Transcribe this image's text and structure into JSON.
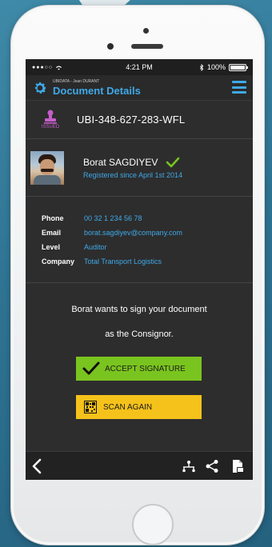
{
  "status_bar": {
    "time": "4:21 PM",
    "battery": "100%",
    "battery_level": 1.0,
    "signal_icon": "signal-dots-icon",
    "wifi_icon": "wifi-icon",
    "bluetooth_icon": "bluetooth-icon"
  },
  "app_bar": {
    "subtitle": "UBIDATA - Jean DURANT",
    "title": "Document Details",
    "logo_icon": "gear-icon",
    "menu_icon": "hamburger-menu-icon",
    "accent_color": "#3fa9e8"
  },
  "document": {
    "status_label": "ISSUED",
    "status_icon": "stamp-icon",
    "status_color": "#c45ec9",
    "id": "UBI-348-627-283-WFL"
  },
  "user": {
    "name": "Borat SAGDIYEV",
    "verified_icon": "checkmark-icon",
    "since": "Registered since April 1st 2014"
  },
  "details": {
    "phone_label": "Phone",
    "phone_value": "00 32 1 234 56 78",
    "email_label": "Email",
    "email_value": "borat.sagdiyev@company.com",
    "level_label": "Level",
    "level_value": "Auditor",
    "company_label": "Company",
    "company_value": "Total Transport Logistics"
  },
  "message": {
    "line1": "Borat wants to sign your document",
    "line2": "as the Consignor."
  },
  "actions": {
    "accept_label": "ACCEPT SIGNATURE",
    "accept_icon": "checkmark-icon",
    "accept_color": "#7ac41f",
    "scan_label": "SCAN AGAIN",
    "scan_icon": "qr-code-icon",
    "scan_color": "#f5c21b"
  },
  "bottom_bar": {
    "back_icon": "chevron-left-icon",
    "network_icon": "network-icon",
    "share_icon": "share-icon",
    "pdf_icon": "pdf-document-icon"
  }
}
